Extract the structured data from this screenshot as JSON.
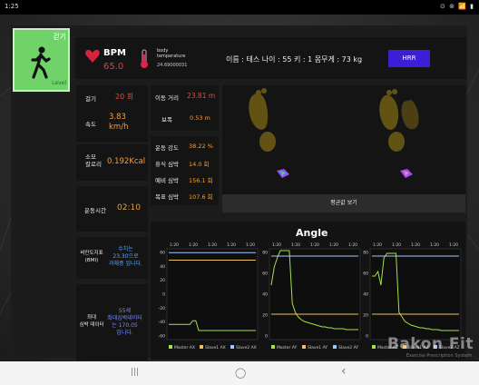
{
  "status": {
    "time": "1:25",
    "icons": "⊙ ⊚ 📶 ▮"
  },
  "walk_tile": {
    "label": "걷기",
    "sublabel": "Level"
  },
  "header": {
    "bpm_label": "BPM",
    "bpm_value": "65.0",
    "temp_label_1": "body",
    "temp_label_2": "temperature",
    "temp_value": "24.69000031",
    "user_info": "이름 : 테스  나이 : 55    키 : 1    몸무게 : 73 kg",
    "hrr_button": "HRR"
  },
  "steps": {
    "label": "걸기",
    "value": "20 회",
    "speed_label": "속도",
    "speed_value": "3.83 km/h"
  },
  "calories": {
    "label_1": "소모",
    "label_2": "칼로리",
    "value": "0.192Kcal"
  },
  "exercise_time": {
    "label": "운동시간",
    "value": "02:10"
  },
  "bmi": {
    "label_1": "비만도지표",
    "label_2": "(BMI)",
    "text_1": "수치는",
    "text_2": "23.30으로",
    "text_3": "과체중 입니다."
  },
  "max_hr": {
    "label_1": "최대",
    "label_2": "심박 데이터",
    "text_1": "55세",
    "text_2": "최대심박데이터",
    "text_3": "는 170.05",
    "text_4": "입니다."
  },
  "distance": {
    "label": "이동 거리",
    "value": "23.81 m",
    "stride_label": "보폭",
    "stride_value": "0.53 m"
  },
  "intensity": {
    "rows": [
      {
        "label": "운동 강도",
        "value": "38.22 %"
      },
      {
        "label": "휴식 심박",
        "value": "14.0 회"
      },
      {
        "label": "예비 심박",
        "value": "156.1 회"
      },
      {
        "label": "목표 심박",
        "value": "107.6 회"
      }
    ]
  },
  "footprint": {
    "button": "평균값 보기"
  },
  "brand": {
    "name": "Bakon Fit",
    "tagline": "Exercise Prescription System"
  },
  "nav": {
    "recent": "|||",
    "home": "◯",
    "back": "‹"
  },
  "colors": {
    "accent_green": "#6fd36a",
    "hrr_blue": "#3a1fd6",
    "value_orange": "#ff9a2e",
    "bmi_blue": "#5aa4ff"
  },
  "chart_data": [
    {
      "type": "line",
      "title": "Angle",
      "x_ticks": [
        "1:20",
        "1:20",
        "1:20",
        "1:20",
        "1:20"
      ],
      "ylim": [
        -60,
        60
      ],
      "y_ticks": [
        "60",
        "40",
        "20",
        "0",
        "-20",
        "-40",
        "-60"
      ],
      "series": [
        {
          "name": "Master AX",
          "color": "#a6e04a",
          "values": [
            -40,
            -40,
            -40,
            -40,
            -40,
            -40,
            -40,
            -40,
            -35,
            -35,
            -48,
            -48,
            -48,
            -48,
            -48,
            -48,
            -48,
            -48,
            -48,
            -48,
            -48,
            -48,
            -48,
            -48,
            -48,
            -48,
            -48,
            -48,
            -48,
            -48
          ]
        },
        {
          "name": "Slave1 AX",
          "color": "#f0c060",
          "values": [
            45,
            45,
            45,
            45,
            45,
            45,
            45,
            45,
            45,
            45,
            45,
            45,
            45,
            45,
            45,
            45,
            45,
            45,
            45,
            45,
            45,
            45,
            45,
            45,
            45,
            45,
            45,
            45,
            45,
            45
          ]
        },
        {
          "name": "Slave2 AX",
          "color": "#a0c8ff",
          "values": [
            55,
            55,
            55,
            55,
            55,
            55,
            55,
            55,
            55,
            55,
            55,
            55,
            55,
            55,
            55,
            55,
            55,
            55,
            55,
            55,
            55,
            55,
            55,
            55,
            55,
            55,
            55,
            55,
            55,
            55
          ]
        }
      ]
    },
    {
      "type": "line",
      "x_ticks": [
        "1:20",
        "1:20",
        "1:20",
        "1:20",
        "1:20"
      ],
      "ylim": [
        0,
        100
      ],
      "y_ticks": [
        "80",
        "60",
        "40",
        "20",
        "0"
      ],
      "series": [
        {
          "name": "Master AY",
          "color": "#a6e04a",
          "values": [
            60,
            80,
            90,
            98,
            98,
            98,
            98,
            40,
            30,
            25,
            22,
            20,
            19,
            18,
            17,
            16,
            15,
            14,
            14,
            13,
            13,
            12,
            12,
            12,
            12,
            11,
            11,
            11,
            11,
            11
          ]
        },
        {
          "name": "Slave1 AY",
          "color": "#f0c060",
          "values": [
            28,
            28,
            28,
            28,
            28,
            28,
            28,
            28,
            28,
            28,
            28,
            28,
            28,
            28,
            28,
            28,
            28,
            28,
            28,
            28,
            28,
            28,
            28,
            28,
            28,
            28,
            28,
            28,
            28,
            28
          ]
        },
        {
          "name": "Slave2 AY",
          "color": "#a0c8ff",
          "values": [
            92,
            92,
            92,
            92,
            92,
            92,
            92,
            92,
            92,
            92,
            92,
            92,
            92,
            92,
            92,
            92,
            92,
            92,
            92,
            92,
            92,
            92,
            92,
            92,
            92,
            92,
            92,
            92,
            92,
            92
          ]
        }
      ]
    },
    {
      "type": "line",
      "x_ticks": [
        "1:20",
        "1:20",
        "1:20",
        "1:20",
        "1:20"
      ],
      "ylim": [
        0,
        100
      ],
      "y_ticks": [
        "80",
        "60",
        "40",
        "20",
        "0"
      ],
      "series": [
        {
          "name": "Master AZ",
          "color": "#a6e04a",
          "values": [
            70,
            70,
            75,
            60,
            90,
            95,
            95,
            95,
            95,
            30,
            25,
            20,
            18,
            16,
            15,
            14,
            13,
            13,
            12,
            12,
            11,
            11,
            11,
            10,
            10,
            10,
            10,
            10,
            10,
            10
          ]
        },
        {
          "name": "Slave1 AZ",
          "color": "#f0c060",
          "values": [
            28,
            28,
            28,
            28,
            28,
            28,
            28,
            28,
            28,
            28,
            28,
            28,
            28,
            28,
            28,
            28,
            28,
            28,
            28,
            28,
            28,
            28,
            28,
            28,
            28,
            28,
            28,
            28,
            28,
            28
          ]
        },
        {
          "name": "Slave2 AZ",
          "color": "#a0c8ff",
          "values": [
            92,
            92,
            92,
            92,
            92,
            92,
            92,
            92,
            92,
            92,
            92,
            92,
            92,
            92,
            92,
            92,
            92,
            92,
            92,
            92,
            92,
            92,
            92,
            92,
            92,
            92,
            92,
            92,
            92,
            92
          ]
        }
      ]
    }
  ]
}
